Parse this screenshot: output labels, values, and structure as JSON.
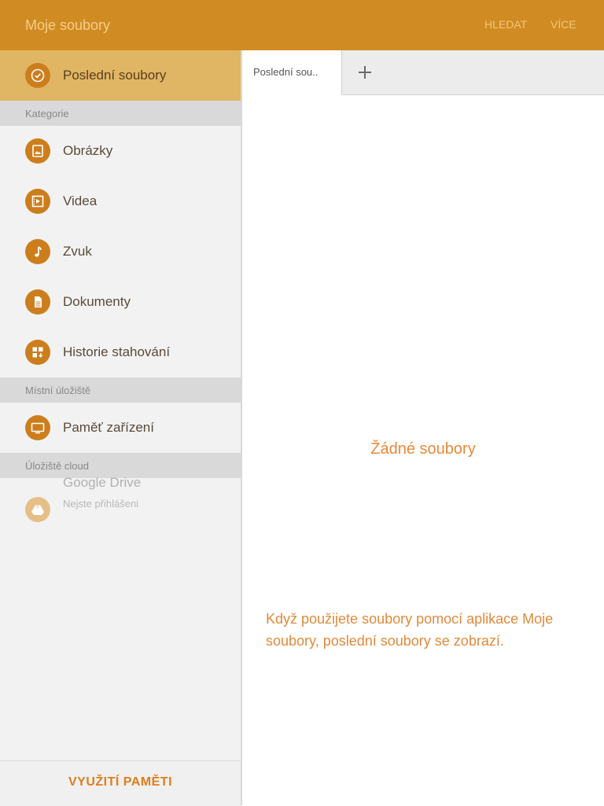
{
  "header": {
    "title": "Moje soubory",
    "actions": [
      "HLEDAT",
      "VÍCE"
    ]
  },
  "sidebar": {
    "recent": {
      "label": "Poslední soubory",
      "icon": "clock-icon"
    },
    "sections": {
      "categories": "Kategorie",
      "local": "Místní úložiště",
      "cloud": "Úložiště cloud"
    },
    "categories": [
      {
        "label": "Obrázky",
        "icon": "image-icon"
      },
      {
        "label": "Videa",
        "icon": "video-icon"
      },
      {
        "label": "Zvuk",
        "icon": "music-note-icon"
      },
      {
        "label": "Dokumenty",
        "icon": "document-icon"
      },
      {
        "label": "Historie stahování",
        "icon": "download-history-icon"
      }
    ],
    "local": [
      {
        "label": "Paměť zařízení",
        "icon": "device-icon"
      }
    ],
    "cloud": [
      {
        "label": "Google Drive",
        "sub": "Nejste přihlášeni",
        "icon": "google-drive-icon"
      }
    ],
    "storage_button": "VYUŽITÍ PAMĚTI"
  },
  "tabs": {
    "items": [
      {
        "label": "Poslední sou.."
      }
    ],
    "add_icon": "plus-icon"
  },
  "main": {
    "empty_title": "Žádné soubory",
    "empty_hint": "Když použijete soubory pomocí aplikace Moje soubory, poslední soubory se zobrazí."
  },
  "colors": {
    "accent": "#d08c23",
    "accent_dark": "#cc7e1d",
    "active_row": "#e0b664",
    "empty_text": "#e8883a"
  }
}
